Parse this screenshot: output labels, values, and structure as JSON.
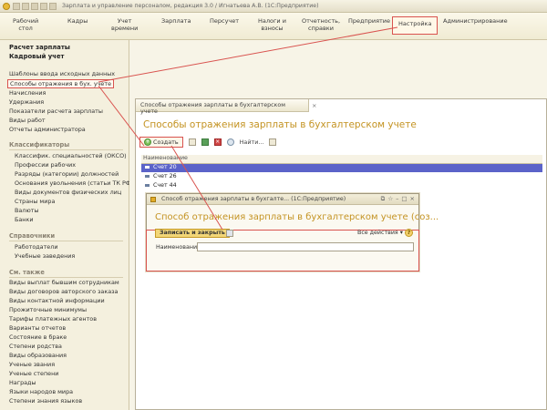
{
  "window": {
    "title": "Зарплата и управление персоналом, редакция 3.0 / Игнатьева А.В.  (1С:Предприятие)"
  },
  "topmenu": [
    {
      "label": "Рабочий\nстол"
    },
    {
      "label": "Кадры"
    },
    {
      "label": "Учет\nвремени"
    },
    {
      "label": "Зарплата"
    },
    {
      "label": "Персучет"
    },
    {
      "label": "Налоги и\nвзносы"
    },
    {
      "label": "Отчетность,\nсправки"
    },
    {
      "label": "Предприятие"
    },
    {
      "label": "Настройка"
    },
    {
      "label": "Администрирование"
    }
  ],
  "sidebar": {
    "title1": "Расчет зарплаты",
    "title2": "Кадровый учет",
    "items": [
      "Шаблоны ввода исходных данных",
      "Способы отражения в бух. учете",
      "Начисления",
      "Удержания",
      "Показатели расчета зарплаты",
      "Виды работ",
      "Отчеты администратора"
    ],
    "classifiers_header": "Классификаторы",
    "classifiers": [
      "Классифик. специальностей (ОКСО)",
      "Профессии рабочих",
      "Разряды (категории) должностей",
      "Основания увольнения (статьи ТК РФ)",
      "Виды документов физических лиц",
      "Страны мира",
      "Валюты",
      "Банки"
    ],
    "references_header": "Справочники",
    "references": [
      "Работодатели",
      "Учебные заведения"
    ],
    "seealso_header": "См. также",
    "seealso": [
      "Виды выплат бывшим сотрудникам",
      "Виды договоров авторского заказа",
      "Виды контактной информации",
      "Прожиточные минимумы",
      "Тарифы платежных агентов",
      "Варианты отчетов",
      "Состояние в браке",
      "Степени родства",
      "Виды образования",
      "Ученые звания",
      "Ученые степени",
      "Награды",
      "Языки народов мира",
      "Степени знания языков"
    ]
  },
  "list": {
    "tab": "Способы отражения зарплаты  в бухгалтерском учете",
    "close": "×",
    "title": "Способы отражения зарплаты  в бухгалтерском учете",
    "create_label": "Создать",
    "find_label": "Найти...",
    "column": "Наименование",
    "rows": [
      "Счет 20",
      "Счет 26",
      "Счет 44"
    ]
  },
  "dialog": {
    "title": "Способ отражения зарплаты  в бухгалте... (1С:Предприятие)",
    "heading": "Способ отражения зарплаты  в бухгалтерском учете (соз...",
    "save_label": "Записать и закрыть",
    "all_actions": "Все действия ▾",
    "help": "?",
    "name_label": "Наименование:",
    "name_value": ""
  },
  "colors": {
    "accent": "#c49322",
    "highlight_red": "#d9534f",
    "selected_row": "#5b63c9"
  }
}
